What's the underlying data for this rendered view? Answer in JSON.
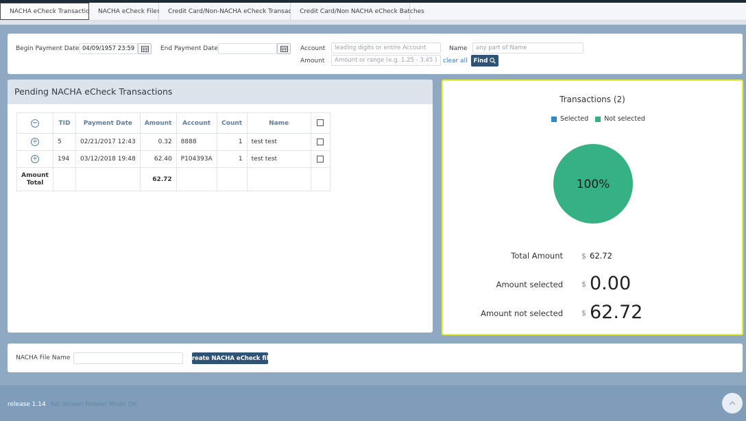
{
  "tabs": [
    {
      "label": "NACHA eCheck Transactions",
      "icon": "document-icon",
      "active": true
    },
    {
      "label": "NACHA eCheck Files",
      "icon": "document-icon",
      "active": false
    },
    {
      "label": "Credit Card/Non-NACHA eCheck Transactions",
      "icon": "credit-card-icon",
      "active": false
    },
    {
      "label": "Credit Card/Non NACHA eCheck Batches",
      "icon": "credit-card-icon",
      "active": false
    }
  ],
  "filter": {
    "begin_label": "Begin Payment Date",
    "begin_value": "04/09/1957 23:59",
    "end_label": "End Payment Date",
    "end_value": "",
    "account_label": "Account",
    "account_placeholder": "leading digits or entire Account",
    "name_label": "Name",
    "name_placeholder": "any part of Name",
    "amount_label": "Amount",
    "amount_placeholder": "Amount or range (e.g. 1.25 - 3.45 )",
    "clear_all": "clear all",
    "find": "Find"
  },
  "pending": {
    "title": "Pending NACHA eCheck Transactions",
    "columns": [
      "TID",
      "Payment Date",
      "Amount",
      "Account",
      "Count",
      "Name"
    ],
    "rows": [
      {
        "tid": "5",
        "date": "02/21/2017 12:43",
        "amount": "0.32",
        "account": "8888",
        "count": "1",
        "name": "test test"
      },
      {
        "tid": "194",
        "date": "03/12/2018 19:48",
        "amount": "62.40",
        "account": "P104393A",
        "count": "1",
        "name": "test test"
      }
    ],
    "total_label_1": "Amount",
    "total_label_2": "Total",
    "total_amount": "62.72"
  },
  "summary": {
    "title": "Transactions (2)",
    "legend_selected": "Selected",
    "legend_not_selected": "Not selected",
    "pie_label": "100%",
    "total_label": "Total Amount",
    "total_value": "62.72",
    "selected_label": "Amount selected",
    "selected_value": "0.00",
    "not_selected_label": "Amount not selected",
    "not_selected_value": "62.72",
    "currency": "$",
    "colors": {
      "selected": "#2f88c8",
      "not_selected": "#36b183"
    }
  },
  "file": {
    "label": "NACHA File Name",
    "value": "",
    "create": "Create NACHA eCheck file"
  },
  "footer": {
    "release": "release 1.14",
    "reader_mode": "Set Screen Reader Mode On"
  }
}
